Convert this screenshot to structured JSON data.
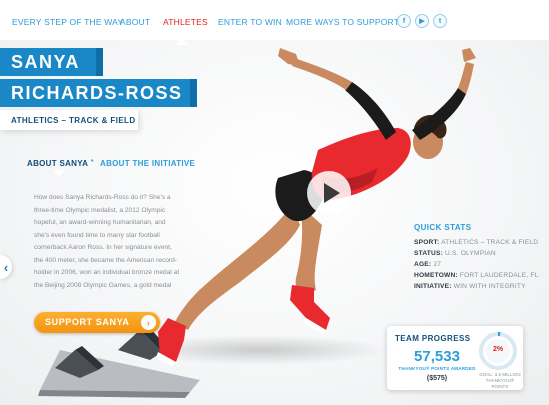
{
  "nav": {
    "items": [
      {
        "label": "EVERY STEP OF THE WAY",
        "active": false
      },
      {
        "label": "ABOUT",
        "active": false
      },
      {
        "label": "ATHLETES",
        "active": true
      },
      {
        "label": "ENTER TO WIN",
        "active": false
      },
      {
        "label": "MORE WAYS TO SUPPORT",
        "active": false
      }
    ],
    "social": [
      {
        "icon": "facebook-icon",
        "glyph": "f"
      },
      {
        "icon": "youtube-icon",
        "glyph": "▶"
      },
      {
        "icon": "twitter-icon",
        "glyph": "t"
      }
    ]
  },
  "athlete": {
    "first_name": "SANYA",
    "last_name": "RICHARDS-ROSS",
    "sport": "ATHLETICS – TRACK & FIELD"
  },
  "tabs": {
    "about": "ABOUT SANYA",
    "initiative": "ABOUT THE INITIATIVE",
    "separator": "•"
  },
  "bio": "How does Sanya Richards-Ross do it? She's a three-time Olympic medalist, a 2012 Olympic hopeful, an award-winning humanitarian, and she's even found time to marry star football cornerback Aaron Ross. In her signature event, the 400 meter, she became the American record-holder in 2006, won an individual bronze medal at the Beijing 2008 Olympic Games, a gold medal",
  "support_button": {
    "label": "SUPPORT SANYA",
    "arrow": "›"
  },
  "prev_arrow": "‹",
  "quick_stats": {
    "title": "QUICK STATS",
    "rows": [
      {
        "label": "SPORT:",
        "value": "ATHLETICS – TRACK & FIELD"
      },
      {
        "label": "STATUS:",
        "value": "U.S. OLYMPIAN"
      },
      {
        "label": "AGE:",
        "value": "27"
      },
      {
        "label": "HOMETOWN:",
        "value": "FORT LAUDERDALE, FL"
      },
      {
        "label": "INITIATIVE:",
        "value": "WIN WITH INTEGRITY"
      }
    ]
  },
  "team_progress": {
    "title": "TEAM PROGRESS",
    "points": "57,533",
    "points_label": "THANKYOU® POINTS AWARDED",
    "dollars": "($575)",
    "percent_label": "2%",
    "percent_value": 0.02,
    "goal_line1": "GOAL: 3.5 MILLION",
    "goal_line2": "THANKYOU® POINTS"
  },
  "colors": {
    "brand_blue": "#1a87c6",
    "link_blue": "#2a9fd8",
    "active_red": "#e2231a",
    "support_orange": "#f39312",
    "athlete_red": "#e8292e"
  }
}
